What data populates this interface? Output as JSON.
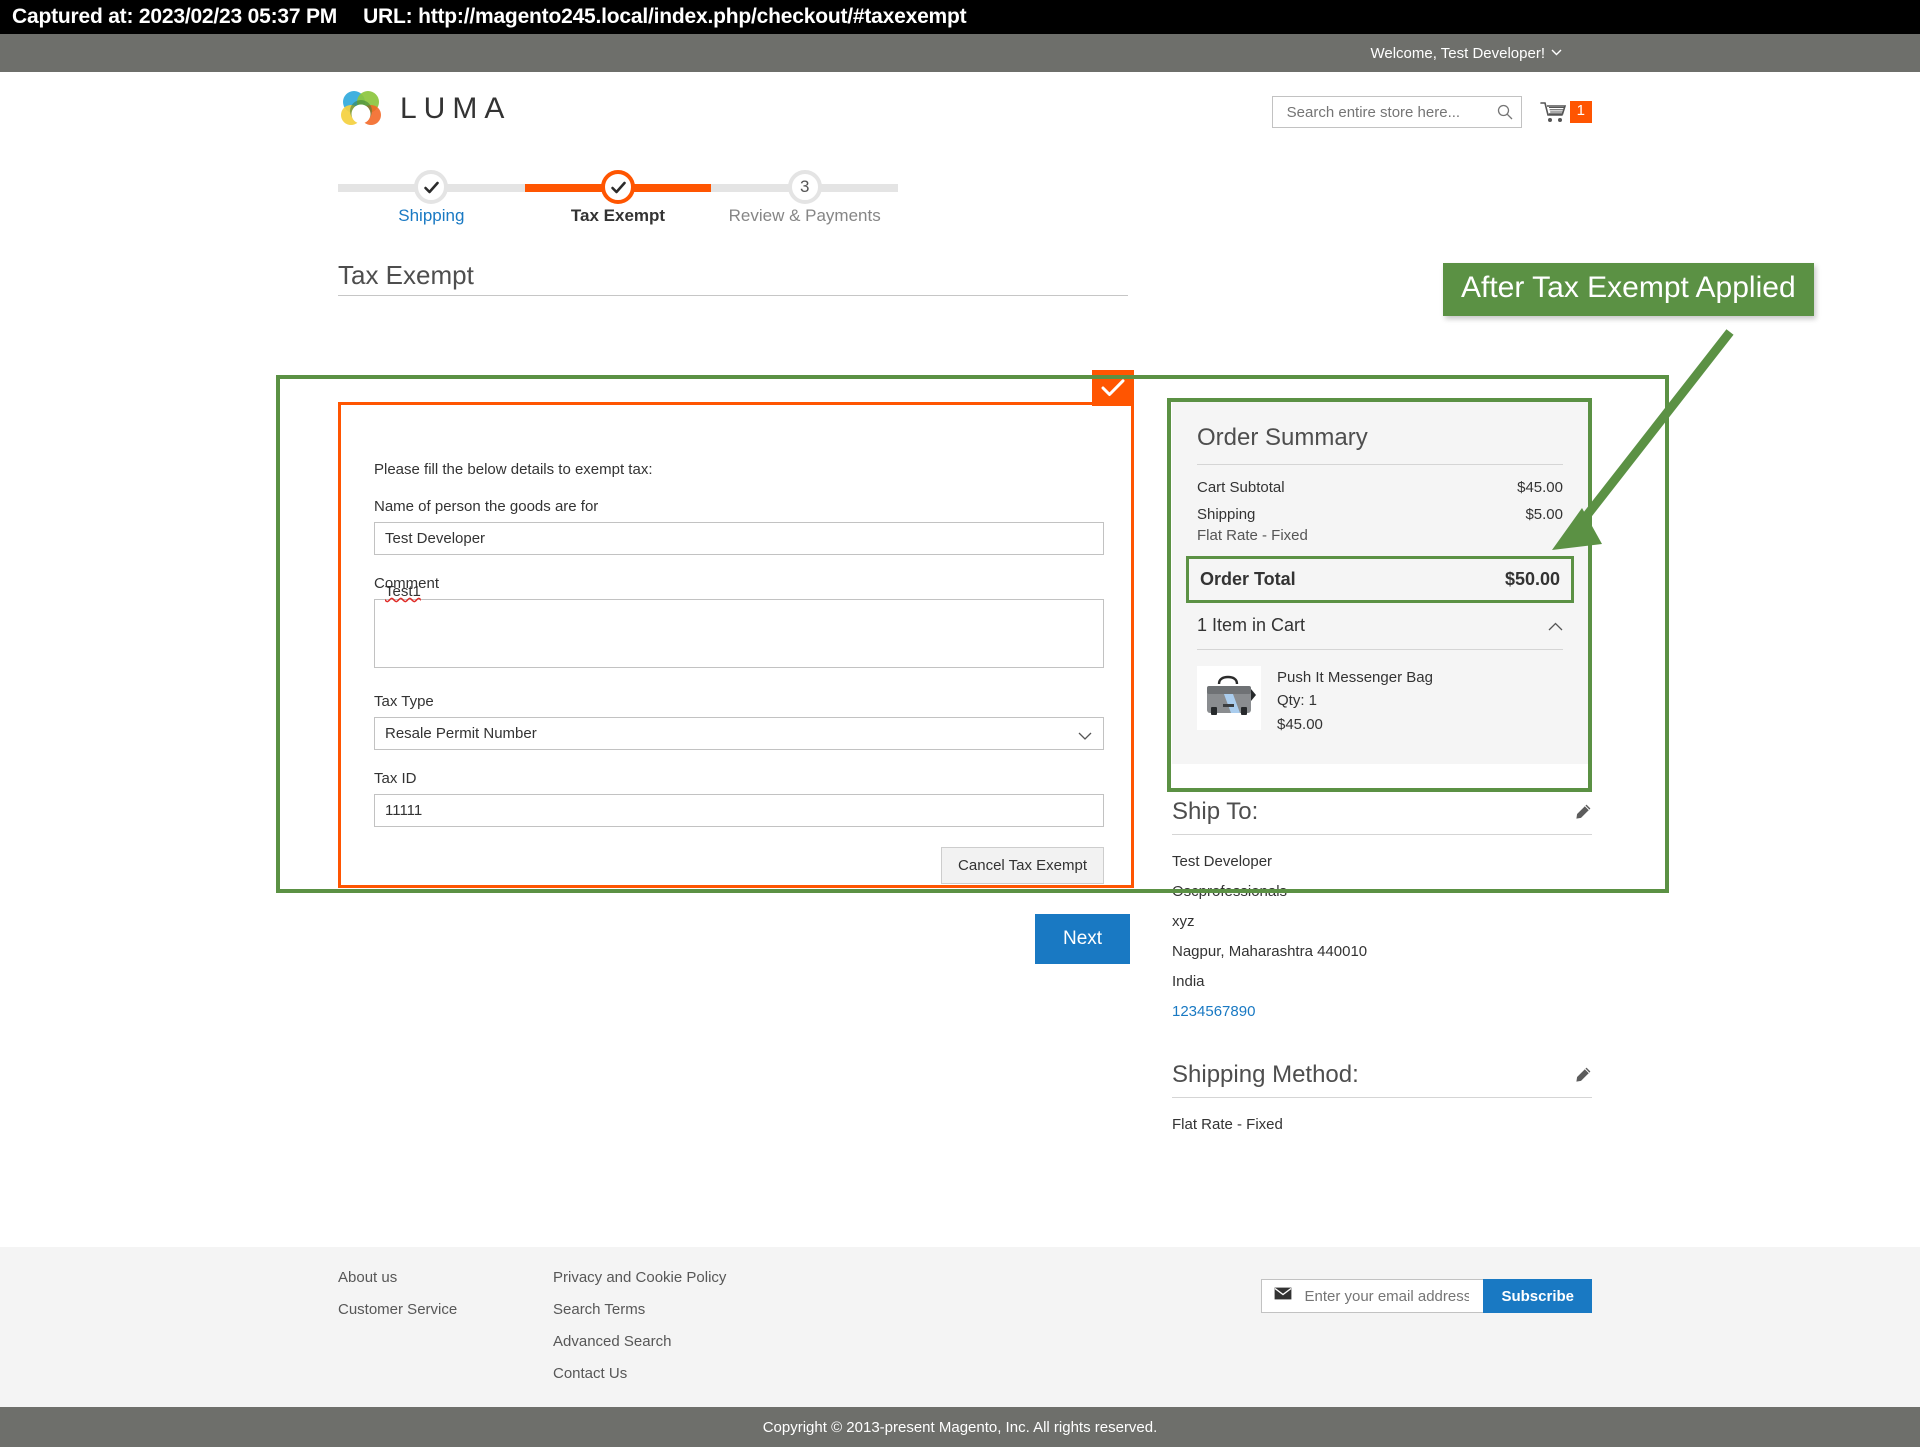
{
  "capture": {
    "captured_label": "Captured at: 2023/02/23 05:37 PM",
    "url_label": "URL: http://magento245.local/index.php/checkout/#taxexempt"
  },
  "welcome": {
    "text": "Welcome, Test Developer!",
    "caret": "⌄"
  },
  "header": {
    "logo_text": "LUMA",
    "search": {
      "placeholder": "Search entire store here...",
      "value": ""
    },
    "cart": {
      "count": "1"
    }
  },
  "stepper": {
    "steps": [
      {
        "label": "Shipping",
        "marker": "check",
        "state": "done"
      },
      {
        "label": "Tax Exempt",
        "marker": "check",
        "state": "active"
      },
      {
        "label": "Review & Payments",
        "marker": "3",
        "state": "pending"
      }
    ]
  },
  "main": {
    "page_title": "Tax Exempt",
    "form": {
      "hint": "Please fill the below details to exempt tax:",
      "name_label": "Name of person the goods are for",
      "name_value": "Test Developer",
      "comment_label": "Comment",
      "comment_value": "Test1",
      "tax_type_label": "Tax Type",
      "tax_type_value": "Resale Permit Number",
      "tax_type_options": [
        "Resale Permit Number"
      ],
      "tax_id_label": "Tax ID",
      "tax_id_value": "11111",
      "cancel_label": "Cancel Tax Exempt"
    },
    "next_label": "Next"
  },
  "sidebar": {
    "summary": {
      "title": "Order Summary",
      "rows": [
        {
          "label": "Cart Subtotal",
          "value": "$45.00",
          "sub": ""
        },
        {
          "label": "Shipping",
          "value": "$5.00",
          "sub": "Flat Rate - Fixed"
        }
      ],
      "total_label": "Order Total",
      "total_value": "$50.00",
      "items_label": "1 Item in Cart",
      "items": [
        {
          "name": "Push It Messenger Bag",
          "qty": "Qty: 1",
          "price": "$45.00"
        }
      ]
    },
    "ship_to": {
      "title": "Ship To:",
      "lines": [
        "Test Developer",
        "Oscprofessionals",
        "xyz",
        "Nagpur, Maharashtra 440010",
        "India"
      ],
      "phone": "1234567890"
    },
    "shipping_method": {
      "title": "Shipping Method:",
      "value": "Flat Rate - Fixed"
    }
  },
  "annotation": {
    "callout_text": "After Tax Exempt Applied",
    "color": "#5b9144"
  },
  "footer": {
    "col1": [
      "About us",
      "Customer Service"
    ],
    "col2": [
      "Privacy and Cookie Policy",
      "Search Terms",
      "Advanced Search",
      "Contact Us"
    ],
    "newsletter": {
      "placeholder": "Enter your email address",
      "value": "",
      "subscribe_label": "Subscribe"
    },
    "copyright": "Copyright © 2013-present Magento, Inc. All rights reserved."
  },
  "colors": {
    "accent_orange": "#ff5501",
    "link_blue": "#1979c3",
    "annotation_green": "#5b9144",
    "bar_gray": "#6e6f6b"
  }
}
